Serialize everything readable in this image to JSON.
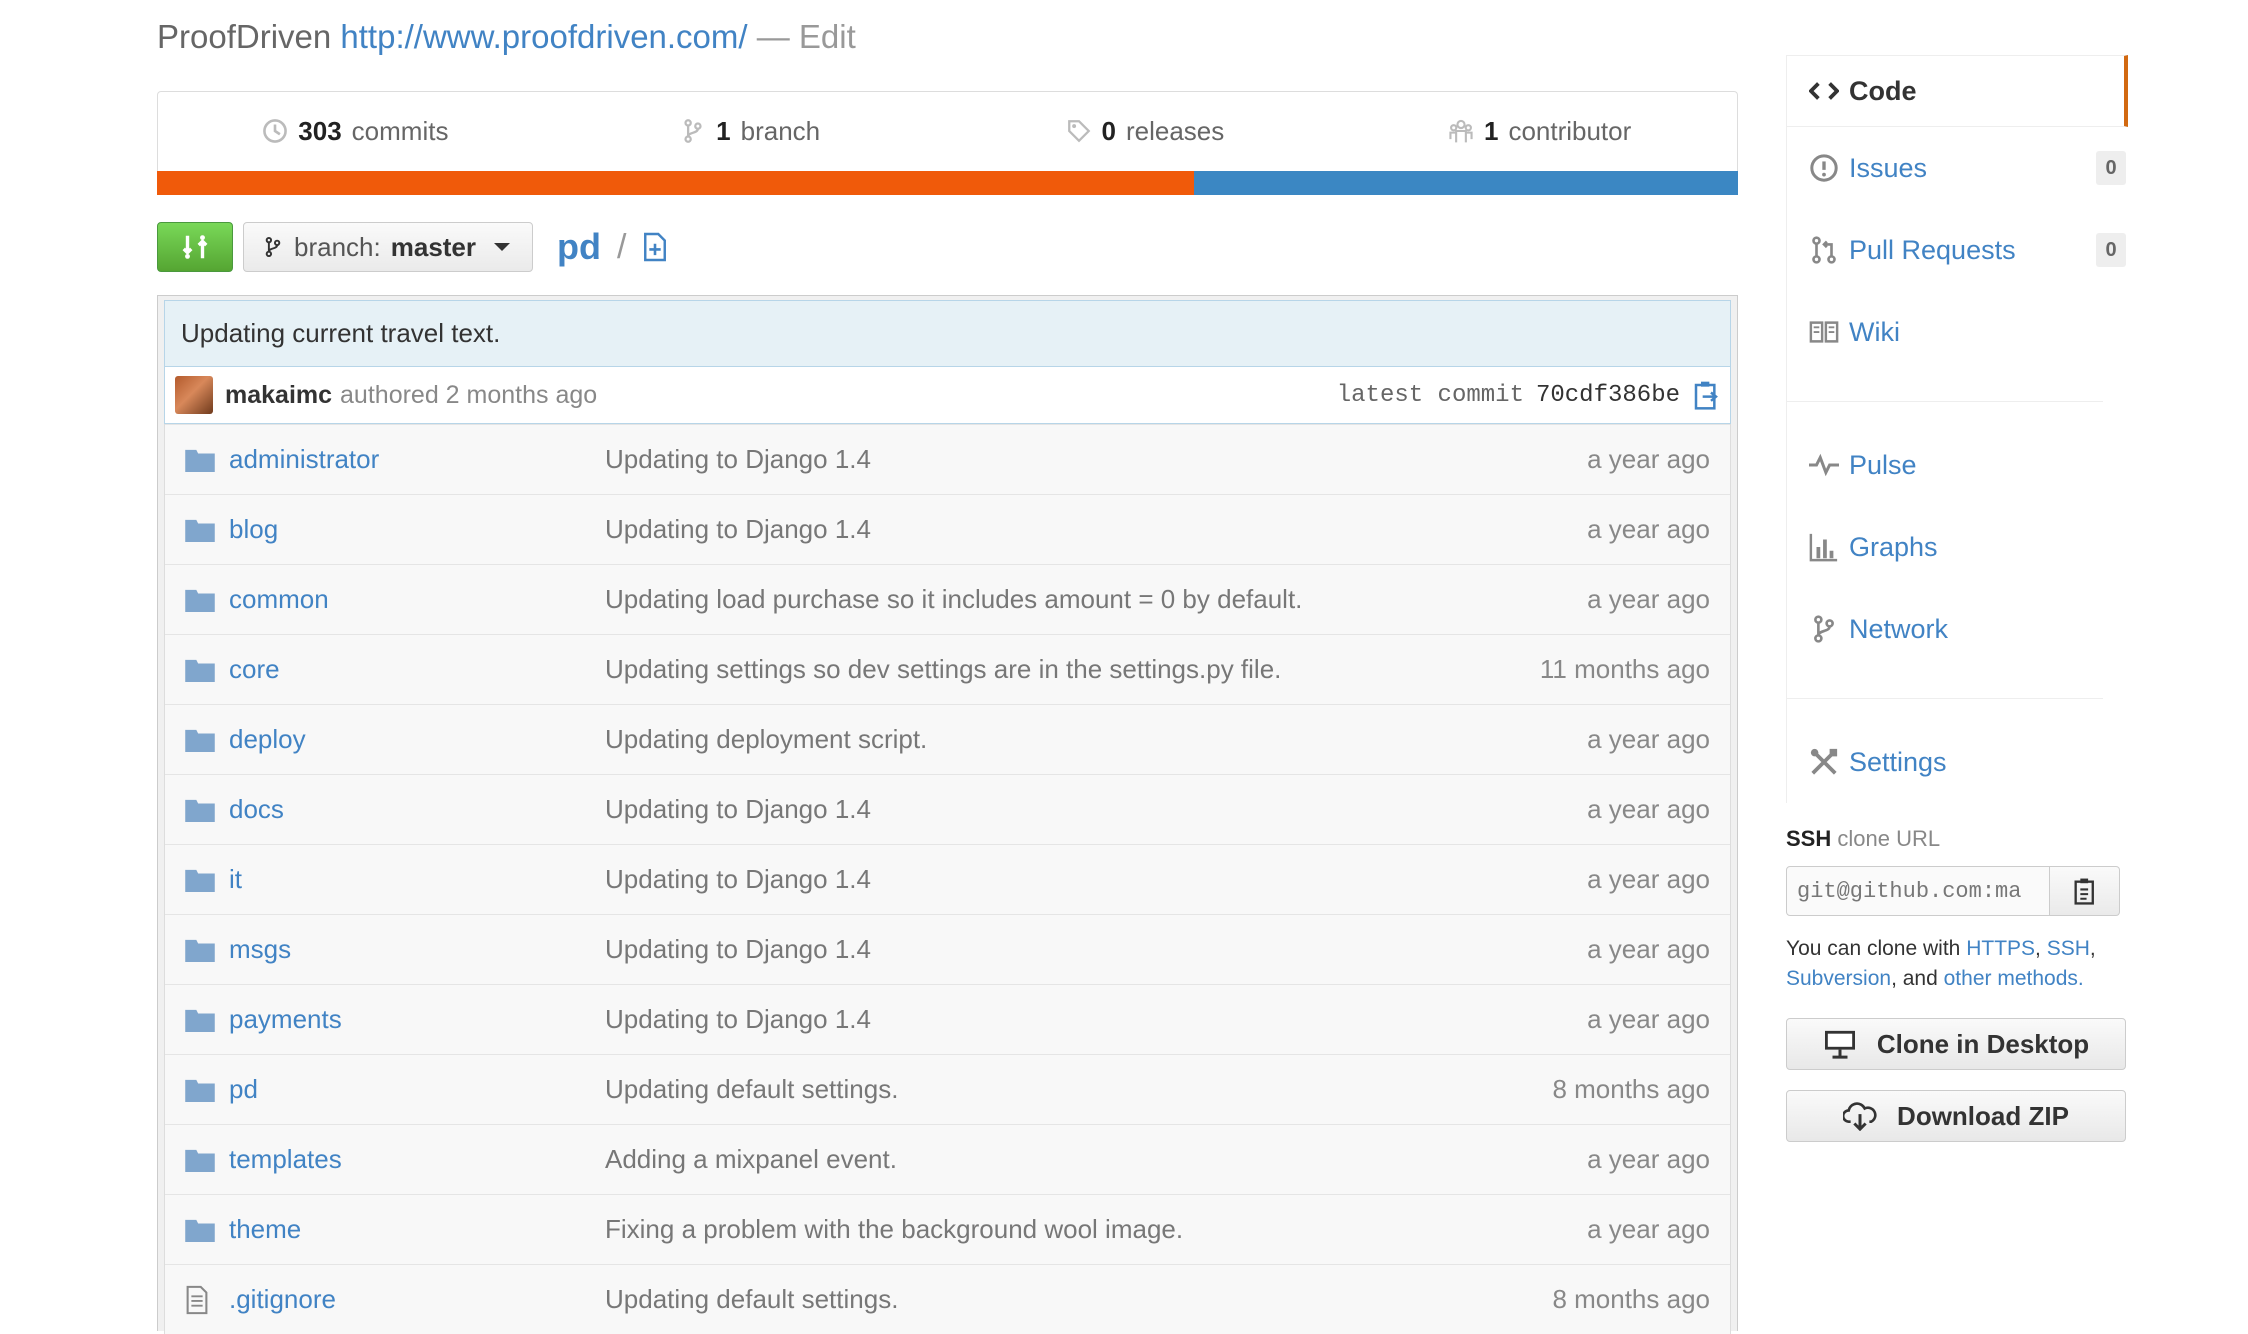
{
  "repo": {
    "name": "ProofDriven",
    "url": "http://www.proofdriven.com/",
    "separator": "—",
    "edit_label": "Edit"
  },
  "stats": [
    {
      "icon": "history-icon",
      "count": "303",
      "label": "commits"
    },
    {
      "icon": "branch-icon",
      "count": "1",
      "label": "branch"
    },
    {
      "icon": "tag-icon",
      "count": "0",
      "label": "releases"
    },
    {
      "icon": "organization-icon",
      "count": "1",
      "label": "contributor"
    }
  ],
  "language_bar": [
    {
      "color": "#f05a0a",
      "percent": 65.6
    },
    {
      "color": "#3b87c3",
      "percent": 34.4
    }
  ],
  "file_nav": {
    "branch_prefix": "branch:",
    "branch_name": "master",
    "path": "pd",
    "path_sep": "/"
  },
  "commit": {
    "message": "Updating current travel text.",
    "author": "makaimc",
    "authored_text": "authored 2 months ago",
    "latest_label": "latest commit",
    "sha": "70cdf386be"
  },
  "files": [
    {
      "type": "dir",
      "name": "administrator",
      "message": "Updating to Django 1.4",
      "age": "a year ago"
    },
    {
      "type": "dir",
      "name": "blog",
      "message": "Updating to Django 1.4",
      "age": "a year ago"
    },
    {
      "type": "dir",
      "name": "common",
      "message": "Updating load purchase so it includes amount = 0 by default.",
      "age": "a year ago"
    },
    {
      "type": "dir",
      "name": "core",
      "message": "Updating settings so dev settings are in the settings.py file.",
      "age": "11 months ago"
    },
    {
      "type": "dir",
      "name": "deploy",
      "message": "Updating deployment script.",
      "age": "a year ago"
    },
    {
      "type": "dir",
      "name": "docs",
      "message": "Updating to Django 1.4",
      "age": "a year ago"
    },
    {
      "type": "dir",
      "name": "it",
      "message": "Updating to Django 1.4",
      "age": "a year ago"
    },
    {
      "type": "dir",
      "name": "msgs",
      "message": "Updating to Django 1.4",
      "age": "a year ago"
    },
    {
      "type": "dir",
      "name": "payments",
      "message": "Updating to Django 1.4",
      "age": "a year ago"
    },
    {
      "type": "dir",
      "name": "pd",
      "message": "Updating default settings.",
      "age": "8 months ago"
    },
    {
      "type": "dir",
      "name": "templates",
      "message": "Adding a mixpanel event.",
      "age": "a year ago"
    },
    {
      "type": "dir",
      "name": "theme",
      "message": "Fixing a problem with the background wool image.",
      "age": "a year ago"
    },
    {
      "type": "file",
      "name": ".gitignore",
      "message": "Updating default settings.",
      "age": "8 months ago"
    }
  ],
  "sidebar": {
    "nav": [
      {
        "label": "Code",
        "icon": "code-icon",
        "selected": true
      },
      {
        "label": "Issues",
        "icon": "issue-icon",
        "counter": "0"
      },
      {
        "label": "Pull Requests",
        "icon": "pull-request-icon",
        "counter": "0"
      },
      {
        "label": "Wiki",
        "icon": "book-icon"
      }
    ],
    "nav2": [
      {
        "label": "Pulse",
        "icon": "pulse-icon"
      },
      {
        "label": "Graphs",
        "icon": "graph-icon"
      },
      {
        "label": "Network",
        "icon": "network-icon"
      }
    ],
    "nav3": [
      {
        "label": "Settings",
        "icon": "tools-icon"
      }
    ]
  },
  "clone": {
    "protocol": "SSH",
    "label": "clone URL",
    "value": "git@github.com:ma",
    "help_prefix": "You can clone with",
    "https": "HTTPS",
    "ssh": "SSH",
    "subversion": "Subversion",
    "and": ", and",
    "other": "other methods.",
    "desktop_button": "Clone in Desktop",
    "zip_button": "Download ZIP"
  },
  "colors": {
    "link": "#4183c4",
    "accent": "#d26911"
  }
}
